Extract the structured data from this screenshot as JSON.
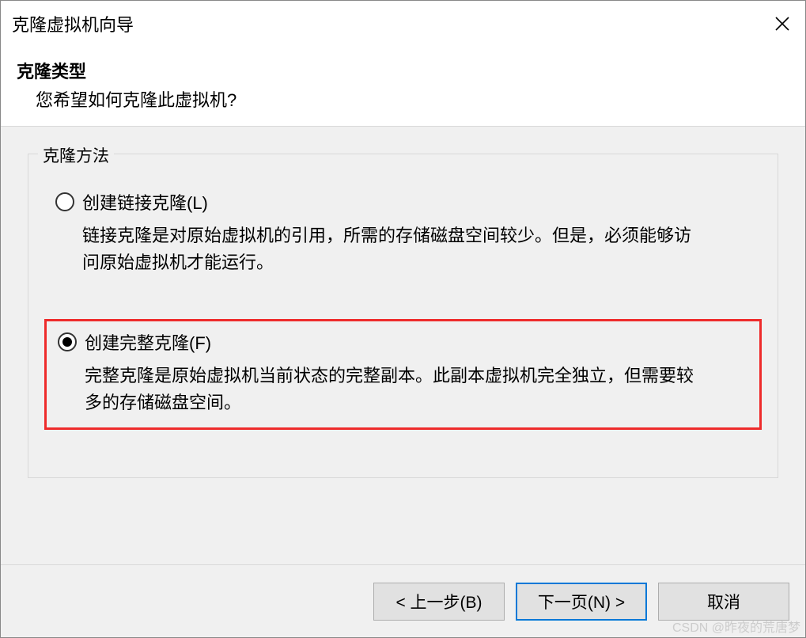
{
  "window": {
    "title": "克隆虚拟机向导"
  },
  "header": {
    "title": "克隆类型",
    "subtitle": "您希望如何克隆此虚拟机?"
  },
  "group": {
    "legend": "克隆方法",
    "options": [
      {
        "label": "创建链接克隆(L)",
        "description": "链接克隆是对原始虚拟机的引用，所需的存储磁盘空间较少。但是，必须能够访问原始虚拟机才能运行。",
        "selected": false
      },
      {
        "label": "创建完整克隆(F)",
        "description": "完整克隆是原始虚拟机当前状态的完整副本。此副本虚拟机完全独立，但需要较多的存储磁盘空间。",
        "selected": true
      }
    ]
  },
  "footer": {
    "back": "< 上一步(B)",
    "next": "下一页(N) >",
    "cancel": "取消"
  },
  "watermark": "CSDN @昨夜的荒唐梦"
}
